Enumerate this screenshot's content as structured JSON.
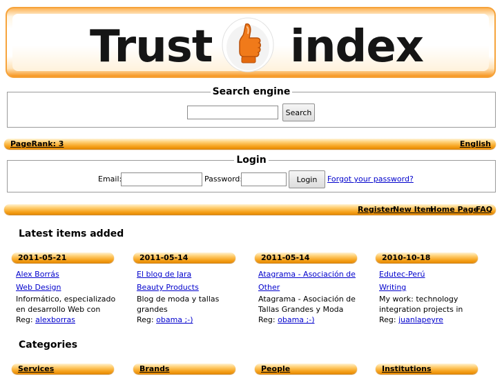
{
  "banner": {
    "brand_left": "Trust",
    "brand_right": "index",
    "logo_icon": "thumbs-up-icon"
  },
  "search": {
    "legend": "Search engine",
    "input_value": "",
    "button_label": "Search"
  },
  "topbar": {
    "pagerank": "PageRank: 3",
    "language": "English"
  },
  "login": {
    "legend": "Login",
    "email_label": "Email:",
    "password_label": "Password:",
    "email_value": "",
    "password_value": "",
    "button_label": "Login",
    "forgot_link": "Forgot your password?"
  },
  "nav": {
    "register": "Register",
    "new_item": "New Item",
    "home_page": "Home Page",
    "faq": "FAQ"
  },
  "latest": {
    "title": "Latest items added",
    "items": [
      {
        "date": "2011-05-21",
        "name": "Alex Borrás",
        "category": "Web Design",
        "desc_1": "Informático, especializado",
        "desc_2": "en desarrollo Web con",
        "reg_label": "Reg:",
        "reg_user": "alexborras"
      },
      {
        "date": "2011-05-14",
        "name": "El blog de Jara",
        "category": "Beauty Products",
        "desc_1": "Blog de moda y tallas",
        "desc_2": "grandes",
        "reg_label": "Reg:",
        "reg_user": "obama ;-)"
      },
      {
        "date": "2011-05-14",
        "name": "Atagrama - Asociación de",
        "category": "Other",
        "desc_1": "Atagrama - Asociación de",
        "desc_2": "Tallas Grandes y Moda",
        "reg_label": "Reg:",
        "reg_user": "obama ;-)"
      },
      {
        "date": "2010-10-18",
        "name": "Edutec-Perú",
        "category": "Writing",
        "desc_1": "My work: technology",
        "desc_2": "integration projects in",
        "reg_label": "Reg:",
        "reg_user": "juanlapeyre"
      }
    ]
  },
  "categories": {
    "title": "Categories",
    "items": [
      "Services",
      "Brands",
      "People",
      "Institutions"
    ]
  },
  "colors": {
    "accent": "#f7a623",
    "link": "#0000cc"
  }
}
